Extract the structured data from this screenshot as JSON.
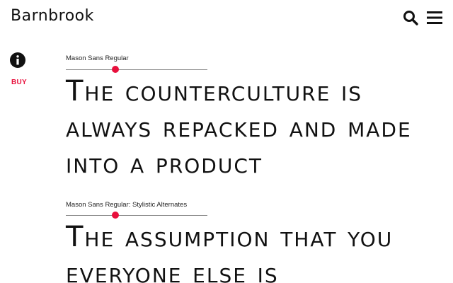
{
  "header": {
    "logo_text": "Barnbrook",
    "search_icon": "search-icon",
    "menu_icon": "hamburger-menu-icon"
  },
  "sidebar": {
    "info_icon": "info-icon",
    "buy_label": "BUY"
  },
  "specimens": [
    {
      "label": "Mason Sans Regular",
      "slider_value": 0.35,
      "text": "The counterculture is always repacked and made into a product"
    },
    {
      "label": "Mason Sans Regular: Stylistic Alternates",
      "slider_value": 0.35,
      "text": "The assumption that you everyone else is"
    }
  ],
  "colors": {
    "accent": "#e8103c",
    "text": "#111111",
    "background": "#ffffff"
  }
}
